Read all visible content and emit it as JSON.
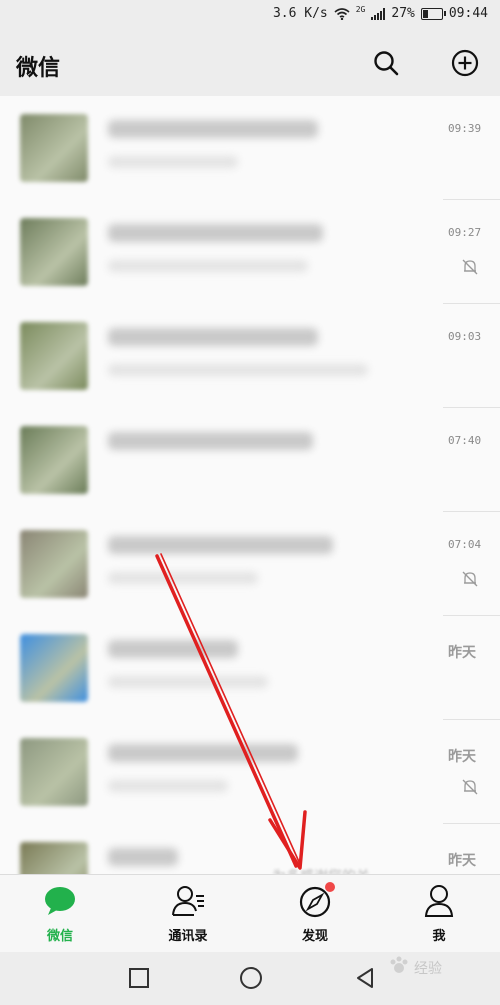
{
  "status_bar": {
    "net_speed": "3.6 K/s",
    "network_type": "2G",
    "battery": "27%",
    "battery_level": 0.27,
    "clock": "09:44"
  },
  "header": {
    "title": "微信",
    "search_icon": "search-icon",
    "add_icon": "plus-circle-icon"
  },
  "chats": [
    {
      "time": "09:39",
      "muted": false,
      "avatar_color": "#7f8a6a"
    },
    {
      "time": "09:27",
      "muted": true,
      "avatar_color": "#6e7d5c"
    },
    {
      "time": "09:03",
      "muted": false,
      "avatar_color": "#7b8b5d"
    },
    {
      "time": "07:40",
      "muted": false,
      "avatar_color": "#6a7c58"
    },
    {
      "time": "07:04",
      "muted": true,
      "avatar_color": "#8a8574"
    },
    {
      "time": "昨天",
      "muted": false,
      "avatar_color": "#3f8fe0"
    },
    {
      "time": "昨天",
      "muted": true,
      "avatar_color": "#8d9880"
    },
    {
      "time": "昨天",
      "muted": false,
      "avatar_color": "#7a7a55"
    }
  ],
  "tabs": [
    {
      "label": "微信",
      "icon": "chat-bubble-icon",
      "active": true
    },
    {
      "label": "通讯录",
      "icon": "contacts-icon",
      "active": false
    },
    {
      "label": "发现",
      "icon": "compass-icon",
      "active": false,
      "badge": true
    },
    {
      "label": "我",
      "icon": "person-icon",
      "active": false
    }
  ],
  "nav": {
    "square": "recent-apps-icon",
    "circle": "home-icon",
    "triangle": "back-icon"
  },
  "colors": {
    "accent": "#22b14c",
    "badge": "#f04848",
    "arrow": "#e02020"
  },
  "watermark": "经验"
}
